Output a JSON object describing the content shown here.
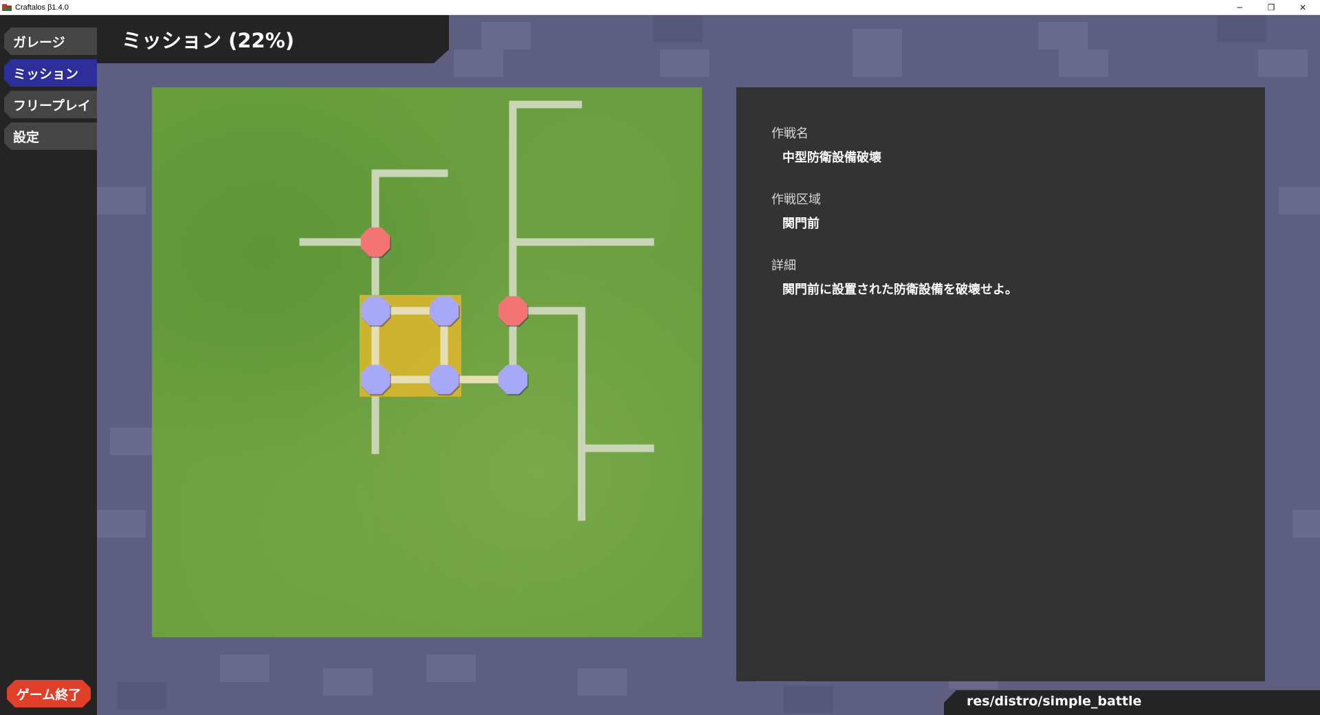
{
  "window": {
    "title": "Craftalos β1.4.0",
    "controls": {
      "minimize": "─",
      "maximize": "❐",
      "close": "✕"
    }
  },
  "sidebar": {
    "items": [
      {
        "label": "ガレージ",
        "active": false
      },
      {
        "label": "ミッション",
        "active": true
      },
      {
        "label": "フリープレイ",
        "active": false
      },
      {
        "label": "設定",
        "active": false
      }
    ],
    "quit_label": "ゲーム終了"
  },
  "header": {
    "title": "ミッション (22%)"
  },
  "mission_map": {
    "node_colors": {
      "cleared": "#a8a8f8",
      "target": "#f47474",
      "highlight": "#d4b430",
      "path": "#c9d6b6"
    }
  },
  "info": {
    "name_label": "作戦名",
    "name_value": "中型防衛設備破壊",
    "area_label": "作戦区域",
    "area_value": "関門前",
    "detail_label": "詳細",
    "detail_value": "関門前に設置された防衛設備を破壊せよ。"
  },
  "footer": {
    "path": "res/distro/simple_battle"
  },
  "colors": {
    "background": "#5e5e80",
    "sidebar": "#242424",
    "active_nav": "#2e2e9a",
    "quit_button": "#e0402a",
    "panel": "#333333"
  }
}
